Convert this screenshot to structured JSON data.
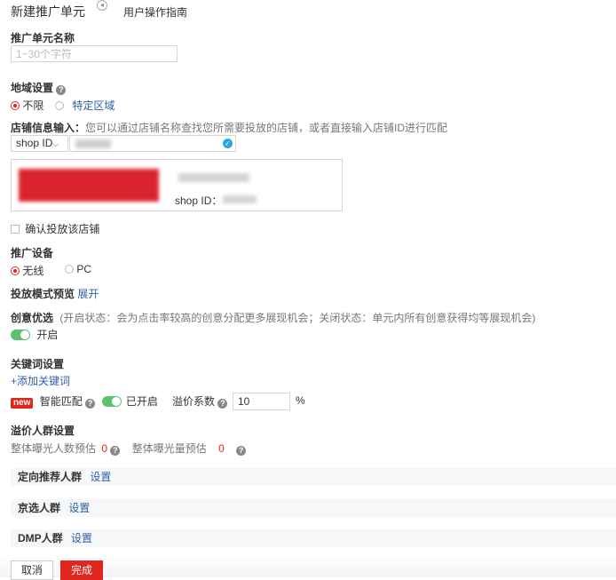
{
  "header": {
    "title": "新建推广单元",
    "guide_link": "用户操作指南"
  },
  "unit_name": {
    "label": "推广单元名称",
    "placeholder": "1~30个字符"
  },
  "region": {
    "label": "地域设置",
    "options": [
      "不限",
      "特定区域"
    ],
    "selected": "不限"
  },
  "shop": {
    "label": "店铺信息输入：",
    "hint": "您可以通过店铺名称查找您所需要投放的店铺，或者直接输入店铺ID进行匹配",
    "type_select": "shop ID",
    "card_id_label": "shop ID：",
    "confirm_label": "确认投放该店铺"
  },
  "device": {
    "label": "推广设备",
    "options": [
      "无线",
      "PC"
    ],
    "selected": "无线"
  },
  "preview": {
    "label": "投放模式预览",
    "expand": "展开"
  },
  "creative": {
    "label": "创意优选",
    "hint": "(开启状态：会为点击率较高的创意分配更多展现机会；关闭状态：单元内所有创意获得均等展现机会)",
    "state": "开启"
  },
  "keywords": {
    "label": "关键词设置",
    "add": "+添加关键词",
    "new_badge": "new",
    "smart_match": "智能匹配",
    "smart_state": "已开启",
    "premium_label": "溢价系数",
    "premium_value": "10",
    "percent": "%"
  },
  "crowd": {
    "label": "溢价人群设置",
    "people_label": "整体曝光人数预估",
    "people_value": "0",
    "volume_label": "整体曝光量预估",
    "volume_value": "0"
  },
  "groups": [
    {
      "name": "定向推荐人群",
      "action": "设置"
    },
    {
      "name": "京选人群",
      "action": "设置"
    },
    {
      "name": "DMP人群",
      "action": "设置"
    }
  ],
  "buttons": {
    "cancel": "取消",
    "finish": "完成"
  },
  "colors": {
    "accent_red": "#e0261e",
    "link_blue": "#2f5fa5",
    "toggle_green": "#5cc26e",
    "valid_blue": "#29a7e1"
  }
}
